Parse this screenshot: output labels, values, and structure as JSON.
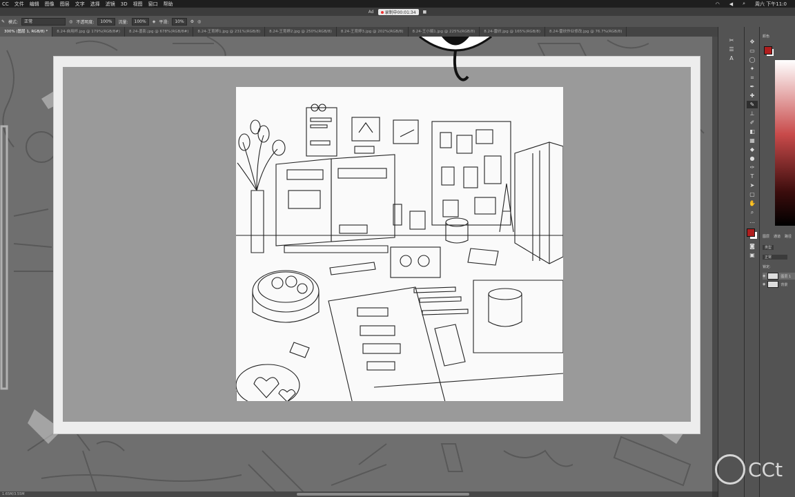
{
  "menubar": {
    "app": "CC",
    "items": [
      "文件",
      "编辑",
      "图像",
      "图层",
      "文字",
      "选择",
      "滤镜",
      "3D",
      "视图",
      "窗口",
      "帮助"
    ],
    "clock": "周六 下午11:0"
  },
  "titlebar": {
    "doc_label": "Ad",
    "recording": "录制中00:01:34"
  },
  "options": {
    "mode_label": "模式:",
    "mode_value": "正常",
    "opacity_label": "不透明度:",
    "opacity_value": "100%",
    "flow_label": "流量:",
    "flow_value": "100%",
    "smooth_label": "平滑:",
    "smooth_value": "10%"
  },
  "tabs": [
    "300% (图层 1, RGB/8) *",
    "8.24-自用杯.jpg @ 179%(RGB/8#)",
    "8.24-墨影.jpg @ 678%(RGB/8#)",
    "8.24-王育婷1.jpg @ 231%(RGB/8)",
    "8.24-王育婷2.jpg @ 250%(RGB/8)",
    "8.24-王育婷3.jpg @ 202%(RGB/8)",
    "8.24-王小娟1.jpg @ 225%(RGB/8)",
    "8.24-雷欣.jpg @ 165%(RGB/8)",
    "8.24-雷欣作业修改.jpg @ 76.7%(RGB/8)"
  ],
  "status": {
    "text": "1.65M/3.55M"
  },
  "panels": {
    "color_tab": "颜色",
    "layers_tab": "图层",
    "channels_tab": "通道",
    "paths_tab": "路径",
    "kind_label": "类型",
    "blend_value": "正常",
    "lock_label": "锁定:",
    "layers": [
      {
        "name": "图层 1",
        "selected": true
      },
      {
        "name": "背景",
        "selected": false
      }
    ]
  },
  "colors": {
    "foreground": "#b01e1e",
    "background": "#ffffff"
  },
  "watermark": {
    "text": "CCt"
  }
}
